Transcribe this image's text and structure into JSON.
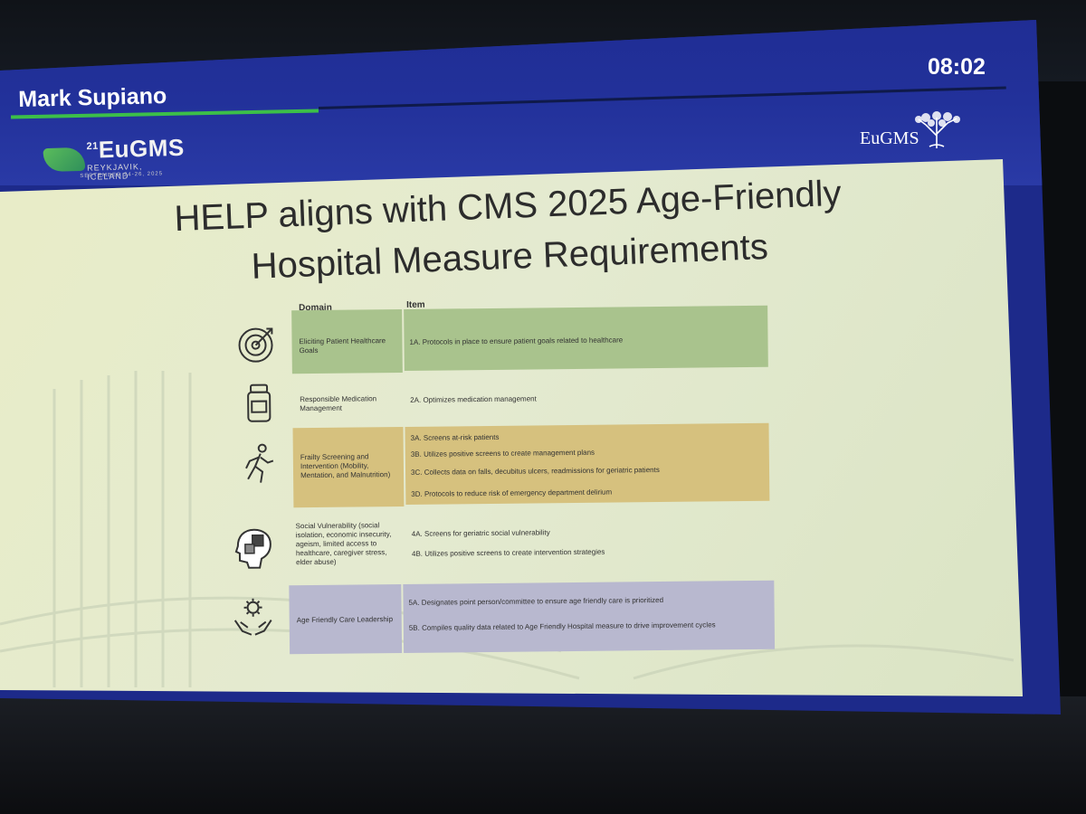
{
  "presenter": "Mark Supiano",
  "timer": "08:02",
  "logo_left": {
    "main": "EuGMS",
    "ordinal": "21",
    "location": "REYKJAVIK, ICELAND",
    "dates": "SEPTEMBER 24-26, 2025"
  },
  "logo_right": "EuGMS",
  "slide": {
    "title_line1": "HELP aligns with CMS 2025 Age-Friendly",
    "title_line2": "Hospital Measure Requirements",
    "columns": {
      "domain": "Domain",
      "item": "Item"
    },
    "rows": [
      {
        "icon": "target-icon",
        "color": "#a9c38d",
        "domain": "Eliciting Patient Healthcare Goals",
        "items": [
          "1A. Protocols in place to ensure patient goals related to healthcare"
        ]
      },
      {
        "icon": "medication-bottle-icon",
        "color": "",
        "domain": "Responsible Medication Management",
        "items": [
          "2A. Optimizes medication management"
        ]
      },
      {
        "icon": "running-person-icon",
        "color": "#d6c17e",
        "domain": "Frailty Screening and Intervention (Mobility, Mentation, and Malnutrition)",
        "items": [
          "3A. Screens at-risk patients",
          "3B. Utilizes positive screens to create management plans",
          "3C. Collects data on falls, decubitus ulcers, readmissions for geriatric patients",
          "3D. Protocols to reduce risk of emergency department delirium"
        ]
      },
      {
        "icon": "puzzle-head-icon",
        "color": "",
        "domain": "Social Vulnerability (social isolation, economic insecurity, ageism, limited access to healthcare, caregiver stress, elder abuse)",
        "items": [
          "4A. Screens for geriatric social vulnerability",
          "4B. Utilizes positive screens to create intervention strategies"
        ]
      },
      {
        "icon": "hands-gear-icon",
        "color": "#b8b8cf",
        "domain": "Age Friendly Care Leadership",
        "items": [
          "5A. Designates point person/committee to ensure age friendly care is prioritized",
          "5B. Compiles quality data related to Age Friendly Hospital measure to drive improvement cycles"
        ]
      }
    ]
  }
}
